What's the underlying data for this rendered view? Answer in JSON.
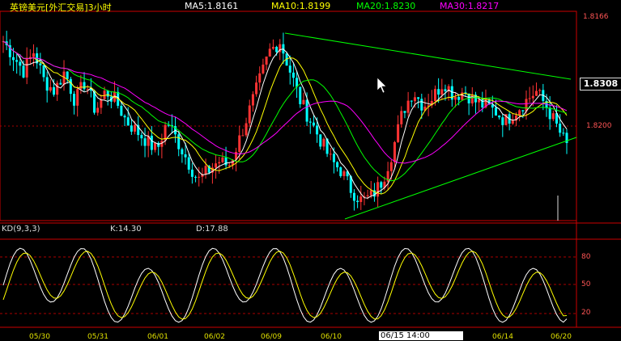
{
  "header": {
    "title": "英镑美元[外汇交易]3小时",
    "ma5": "MA5:1.8161",
    "ma10": "MA10:1.8199",
    "ma20": "MA20:1.8230",
    "ma30": "MA30:1.8217"
  },
  "kd_header": {
    "name": "KD(9,3,3)",
    "k": "K:14.30",
    "d": "D:17.88"
  },
  "price_axis": {
    "top": "1.8166",
    "mid": "1.8200",
    "current": "1.8308"
  },
  "kd_axis": {
    "l80": "80",
    "l50": "50",
    "l20": "20"
  },
  "x_labels": [
    "05/30",
    "05/31",
    "06/01",
    "06/02",
    "06/09",
    "06/10",
    "06/14",
    "06/20"
  ],
  "cursor_time": "06/15 14:00",
  "colors": {
    "title": "#ffff00",
    "ma5": "#ffffff",
    "ma10": "#ffff00",
    "ma20": "#00ff00",
    "ma30": "#ff00ff",
    "up_candle": "#ff3333",
    "down_candle": "#00ffff",
    "trend": "#00ff00",
    "grid": "#aa0000"
  },
  "chart_data": {
    "type": "candlestick",
    "symbol": "GBPUSD",
    "timeframe": "3H",
    "price_ylim": [
      1.812,
      1.833
    ],
    "price_anchors_close": [
      1.83,
      1.8285,
      1.827,
      1.829,
      1.826,
      1.825,
      1.827,
      1.824,
      1.826,
      1.823,
      1.825,
      1.824,
      1.822,
      1.821,
      1.82,
      1.819,
      1.822,
      1.82,
      1.818,
      1.816,
      1.817,
      1.818,
      1.8175,
      1.82,
      1.823,
      1.826,
      1.829,
      1.83,
      1.827,
      1.824,
      1.822,
      1.82,
      1.818,
      1.817,
      1.815,
      1.814,
      1.8145,
      1.816,
      1.819,
      1.823,
      1.825,
      1.8235,
      1.8245,
      1.826,
      1.8245,
      1.825,
      1.824,
      1.8235,
      1.823,
      1.822,
      1.823,
      1.824,
      1.825,
      1.8235,
      1.8215,
      1.8195
    ],
    "kd": {
      "k_last": 14.3,
      "d_last": 17.88,
      "levels": [
        80,
        50,
        20
      ]
    }
  }
}
